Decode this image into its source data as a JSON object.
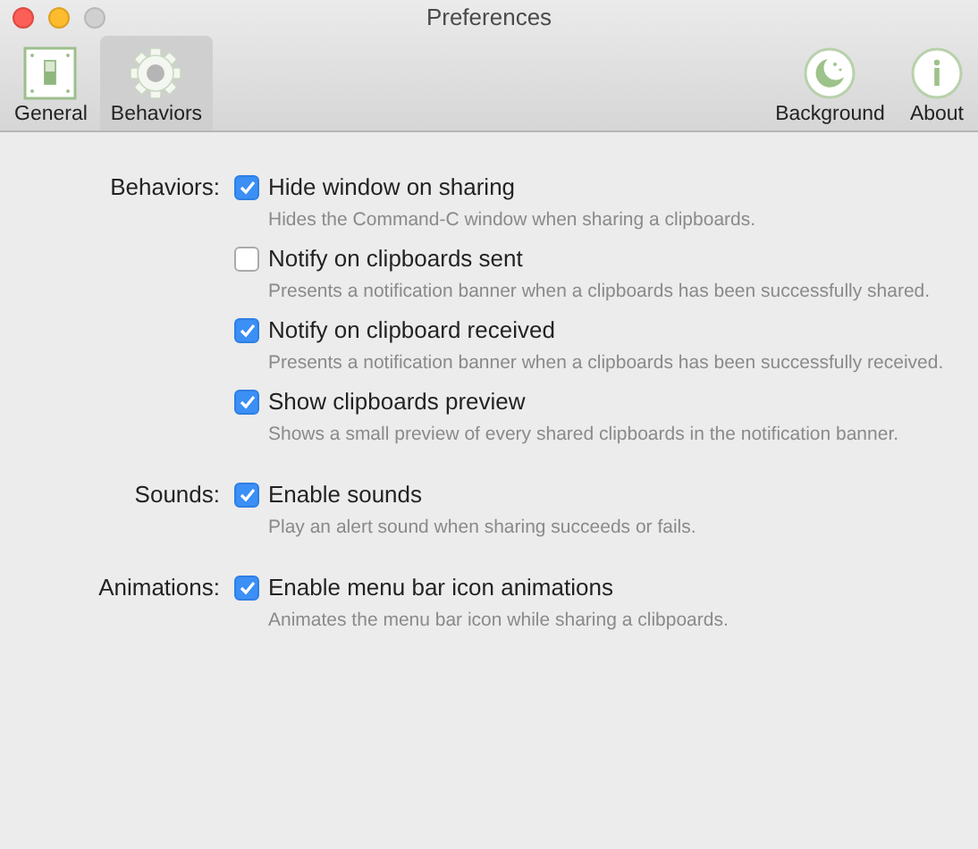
{
  "window": {
    "title": "Preferences"
  },
  "toolbar": {
    "left": [
      {
        "label": "General",
        "kind": "switch",
        "selected": false
      },
      {
        "label": "Behaviors",
        "kind": "gear",
        "selected": true
      }
    ],
    "right": [
      {
        "label": "Background",
        "kind": "moon",
        "selected": false
      },
      {
        "label": "About",
        "kind": "info",
        "selected": false
      }
    ]
  },
  "sections": [
    {
      "label": "Behaviors:",
      "options": [
        {
          "label": "Hide window on sharing",
          "checked": true,
          "description": "Hides the Command-C window when sharing a clipboards."
        },
        {
          "label": "Notify on clipboards sent",
          "checked": false,
          "description": "Presents a notification banner when a clipboards has been successfully shared."
        },
        {
          "label": "Notify on clipboard received",
          "checked": true,
          "description": "Presents a notification banner when a clipboards has been successfully received."
        },
        {
          "label": "Show clipboards preview",
          "checked": true,
          "description": "Shows a small preview of every shared clipboards in the notification banner."
        }
      ]
    },
    {
      "label": "Sounds:",
      "options": [
        {
          "label": "Enable sounds",
          "checked": true,
          "description": "Play an alert sound when sharing succeeds or fails."
        }
      ]
    },
    {
      "label": "Animations:",
      "options": [
        {
          "label": "Enable menu bar icon animations",
          "checked": true,
          "description": "Animates the menu bar icon while sharing a clibpoards."
        }
      ]
    }
  ]
}
